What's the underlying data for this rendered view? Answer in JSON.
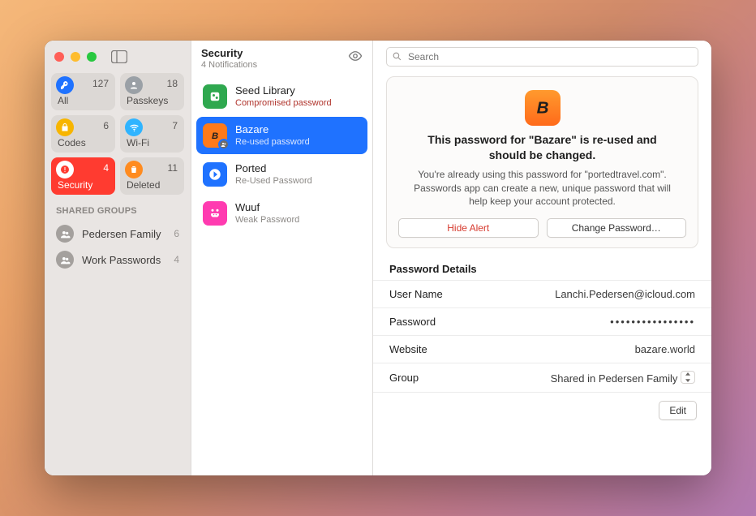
{
  "sidebar": {
    "tiles": [
      {
        "id": "all",
        "label": "All",
        "count": "127",
        "bg": "#1f72ff",
        "icon": "key"
      },
      {
        "id": "passkeys",
        "label": "Passkeys",
        "count": "18",
        "bg": "#9aa0a6",
        "icon": "person"
      },
      {
        "id": "codes",
        "label": "Codes",
        "count": "6",
        "bg": "#f7b500",
        "icon": "lock"
      },
      {
        "id": "wifi",
        "label": "Wi-Fi",
        "count": "7",
        "bg": "#2fb4ff",
        "icon": "wifi"
      },
      {
        "id": "security",
        "label": "Security",
        "count": "4",
        "bg": "#ff3b30",
        "icon": "alert",
        "selected": true
      },
      {
        "id": "deleted",
        "label": "Deleted",
        "count": "11",
        "bg": "#ff8b1f",
        "icon": "trash"
      }
    ],
    "shared_groups_label": "SHARED GROUPS",
    "groups": [
      {
        "label": "Pedersen Family",
        "count": "6"
      },
      {
        "label": "Work Passwords",
        "count": "4"
      }
    ]
  },
  "middle": {
    "title": "Security",
    "subtitle": "4 Notifications",
    "items": [
      {
        "id": "seed",
        "name": "Seed Library",
        "sub": "Compromised password",
        "sub_style": "red",
        "logo_bg": "#2fa84f",
        "shared": false
      },
      {
        "id": "bazare",
        "name": "Bazare",
        "sub": "Re-used password",
        "sub_style": "sel",
        "logo_bg": "#ff7a1a",
        "shared": true,
        "selected": true
      },
      {
        "id": "ported",
        "name": "Ported",
        "sub": "Re-Used Password",
        "sub_style": "gray",
        "logo_bg": "#1f72ff",
        "shared": false
      },
      {
        "id": "wuuf",
        "name": "Wuuf",
        "sub": "Weak Password",
        "sub_style": "gray",
        "logo_bg": "#ff3bb0",
        "shared": false
      }
    ]
  },
  "search": {
    "placeholder": "Search"
  },
  "alert": {
    "logo_bg": "#ff7a1a",
    "title": "This password for \"Bazare\" is re-used and should be changed.",
    "body": "You're already using this password for \"portedtravel.com\". Passwords app can create a new, unique password that will help keep your account protected.",
    "hide_label": "Hide Alert",
    "change_label": "Change Password…"
  },
  "details": {
    "section_title": "Password Details",
    "username_label": "User Name",
    "username_value": "Lanchi.Pedersen@icloud.com",
    "password_label": "Password",
    "password_value": "••••••••••••••••",
    "website_label": "Website",
    "website_value": "bazare.world",
    "group_label": "Group",
    "group_value": "Shared in Pedersen Family",
    "edit_label": "Edit"
  }
}
